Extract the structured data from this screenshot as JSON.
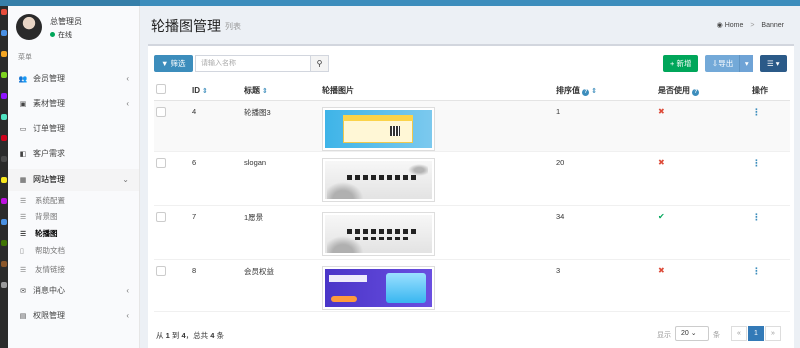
{
  "user": {
    "name": "总管理员",
    "status": "在线"
  },
  "menu_header": "菜单",
  "menu": [
    {
      "label": "会员管理",
      "icon": "users-icon",
      "glyph": "👥",
      "chev": "‹"
    },
    {
      "label": "素材管理",
      "icon": "image-icon",
      "glyph": "▣",
      "chev": "‹"
    },
    {
      "label": "订单管理",
      "icon": "list-icon",
      "glyph": "▭",
      "chev": ""
    },
    {
      "label": "客户需求",
      "icon": "request-icon",
      "glyph": "◧",
      "chev": ""
    },
    {
      "label": "网站管理",
      "icon": "grid-icon",
      "glyph": "▦",
      "chev": "⌄"
    }
  ],
  "submenu": [
    {
      "label": "系统配置",
      "active": false
    },
    {
      "label": "背景图",
      "active": false
    },
    {
      "label": "轮播图",
      "active": true
    },
    {
      "label": "帮助文档",
      "active": false
    },
    {
      "label": "友情链接",
      "active": false
    }
  ],
  "menu_bottom": [
    {
      "label": "消息中心",
      "icon": "mail-icon",
      "glyph": "✉",
      "chev": "‹"
    },
    {
      "label": "权限管理",
      "icon": "lock-icon",
      "glyph": "▤",
      "chev": "‹"
    }
  ],
  "page": {
    "title": "轮播图管理",
    "subtitle": "列表"
  },
  "breadcrumb": {
    "home": "Home",
    "sep": ">",
    "current": "Banner"
  },
  "toolbar": {
    "filter": "▼ 筛选",
    "search_placeholder": "请输入名称",
    "search_glyph": "⚲",
    "add": "+ 新增",
    "export": "⇩导出",
    "export_caret": "▾",
    "columns": "☰ ▾"
  },
  "table": {
    "headers": {
      "id": "ID",
      "title": "标题",
      "image": "轮播图片",
      "sort": "排序值",
      "used": "是否使用",
      "ops": "操作"
    },
    "sort_glyph": "⇕",
    "help_glyph": "?",
    "rows": [
      {
        "id": "4",
        "title": "轮播图3",
        "sort": "1",
        "used": false,
        "used_glyph": "✖",
        "ops_glyph": "⋮"
      },
      {
        "id": "6",
        "title": "slogan",
        "sort": "20",
        "used": false,
        "used_glyph": "✖",
        "ops_glyph": "⋮"
      },
      {
        "id": "7",
        "title": "1愿景",
        "sort": "34",
        "used": true,
        "used_glyph": "✔",
        "ops_glyph": "⋮"
      },
      {
        "id": "8",
        "title": "会员权益",
        "sort": "3",
        "used": false,
        "used_glyph": "✖",
        "ops_glyph": "⋮"
      }
    ]
  },
  "footer": {
    "prefix": "从",
    "from": "1",
    "to_word": "到",
    "to": "4",
    "total_word": "，总共",
    "total": "4",
    "suffix": "条"
  },
  "pager": {
    "show": "显示",
    "page_size": "20",
    "caret": "⌄",
    "unit": "条",
    "prev": "«",
    "current": "1",
    "next": "»"
  },
  "colors": {
    "primary": "#3c8dbc",
    "success": "#00a65a",
    "danger": "#dd4b39",
    "header": "#3c8dbc"
  }
}
